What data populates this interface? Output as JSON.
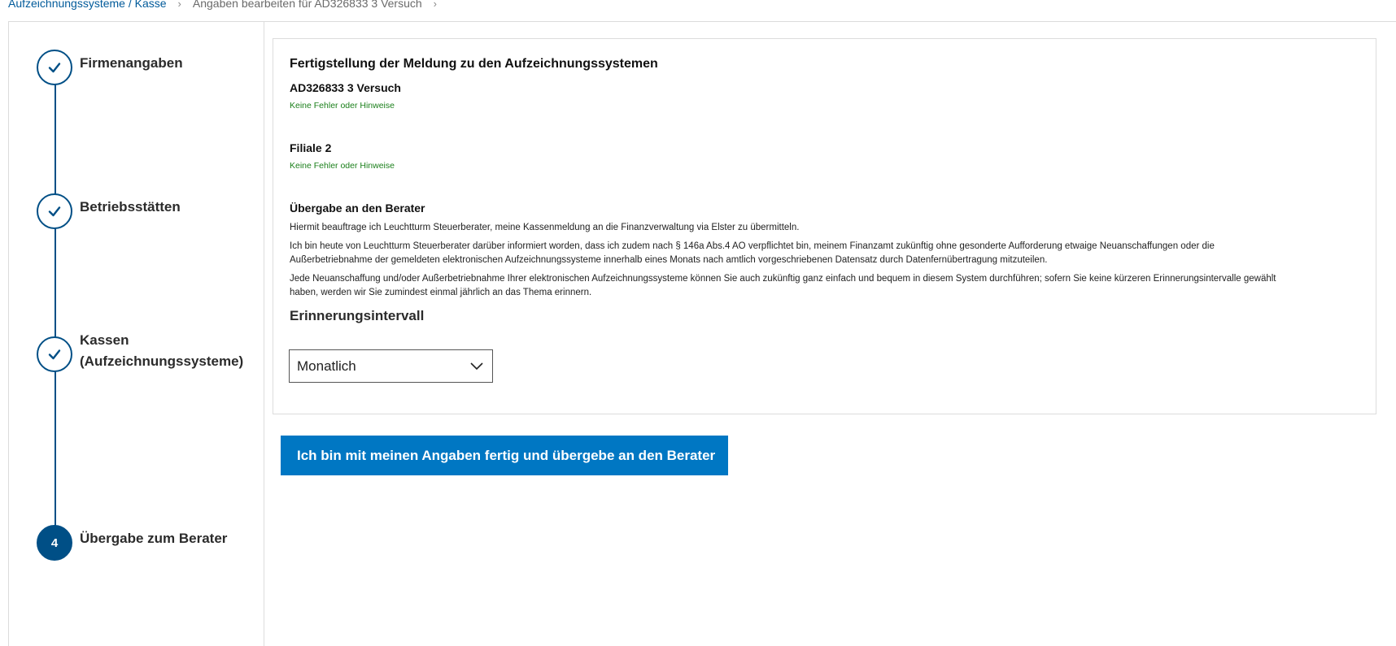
{
  "breadcrumb": {
    "link": "Aufzeichnungssysteme / Kasse",
    "current": "Angaben bearbeiten für AD326833 3 Versuch"
  },
  "stepper": {
    "steps": [
      {
        "label": "Firmenangaben",
        "state": "done"
      },
      {
        "label": "Betriebsstätten",
        "state": "done"
      },
      {
        "label_line1": "Kassen",
        "label_line2": "(Aufzeichnungssysteme)",
        "state": "done"
      },
      {
        "number": "4",
        "label": "Übergabe zum Berater",
        "state": "active"
      }
    ]
  },
  "card": {
    "title": "Fertigstellung der Meldung zu den Aufzeichnungssystemen",
    "entries": [
      {
        "title": "AD326833 3 Versuch",
        "status": "Keine Fehler oder Hinweise"
      },
      {
        "title": "Filiale 2",
        "status": "Keine Fehler oder Hinweise"
      }
    ],
    "handover": {
      "title": "Übergabe an den Berater",
      "para1": "Hiermit beauftrage ich Leuchtturm Steuerberater, meine Kassenmeldung an die Finanzverwaltung via Elster zu übermitteln.",
      "para2_line1": "Ich bin heute von Leuchtturm Steuerberater darüber informiert worden, dass ich zudem nach § 146a Abs.4 AO verpflichtet bin, meinem Finanzamt zukünftig ohne gesonderte Aufforderung etwaige Neuanschaffungen oder die",
      "para2_line2": "Außerbetriebnahme der gemeldeten elektronischen Aufzeichnungssysteme innerhalb eines Monats nach amtlich vorgeschriebenen Datensatz durch Datenfernübertragung mitzuteilen.",
      "para3_line1": "Jede Neuanschaffung und/oder Außerbetriebnahme Ihrer elektronischen Aufzeichnungssysteme können Sie auch zukünftig ganz einfach und bequem in diesem System durchführen; sofern Sie keine kürzeren Erinnerungsintervalle gewählt",
      "para3_line2": "haben, werden wir Sie zumindest einmal jährlich an das Thema erinnern."
    },
    "interval": {
      "label": "Erinnerungsintervall",
      "selected": "Monatlich"
    }
  },
  "submit_button": "Ich bin mit meinen Angaben fertig und übergebe an den Berater",
  "colors": {
    "primary": "#004f86",
    "button": "#0077c3",
    "success": "#1a7f1a",
    "link": "#005a9a"
  },
  "icons": {
    "step_done": "checkmark-icon",
    "select": "chevron-down-icon",
    "breadcrumb_separator": "chevron-right-icon"
  }
}
